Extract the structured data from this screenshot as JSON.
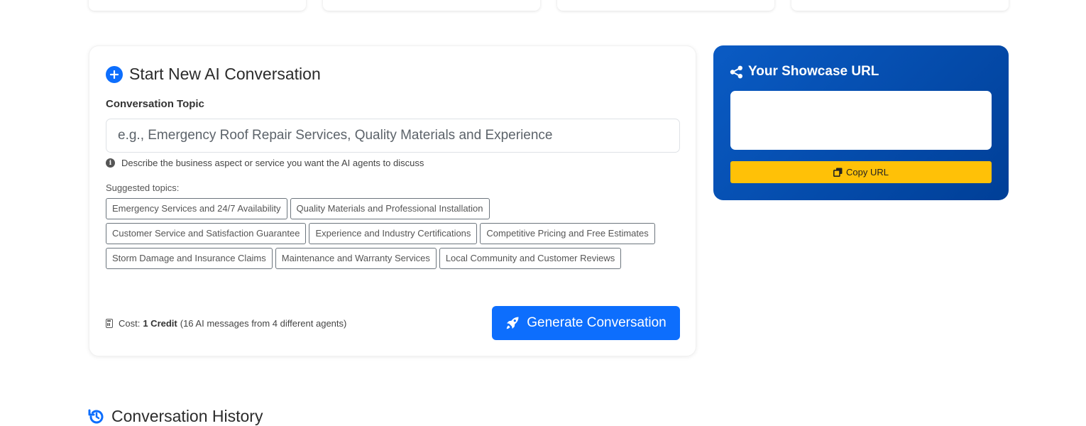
{
  "conversation": {
    "title": "Start New AI Conversation",
    "topic_label": "Conversation Topic",
    "topic_value": "",
    "topic_placeholder": "e.g., Emergency Roof Repair Services, Quality Materials and Experience",
    "help_text": "Describe the business aspect or service you want the AI agents to discuss",
    "suggested_label": "Suggested topics:",
    "suggested_topics": [
      "Emergency Services and 24/7 Availability",
      "Quality Materials and Professional Installation",
      "Customer Service and Satisfaction Guarantee",
      "Experience and Industry Certifications",
      "Competitive Pricing and Free Estimates",
      "Storm Damage and Insurance Claims",
      "Maintenance and Warranty Services",
      "Local Community and Customer Reviews"
    ],
    "cost_prefix": "Cost:",
    "cost_value": "1 Credit",
    "cost_detail": "(16 AI messages from 4 different agents)",
    "generate_label": "Generate Conversation"
  },
  "showcase": {
    "title": "Your Showcase URL",
    "url_value": "",
    "copy_label": "Copy URL"
  },
  "history": {
    "title": "Conversation History"
  },
  "colors": {
    "primary": "#0d6efd",
    "showcase_bg": "#0050b3",
    "copy_button": "#ffc107"
  },
  "icons": {
    "title": "plus-circle-icon",
    "help": "info-circle-icon",
    "cost": "calculator-icon",
    "generate": "rocket-icon",
    "showcase": "share-icon",
    "copy": "copy-icon",
    "history": "history-icon"
  }
}
